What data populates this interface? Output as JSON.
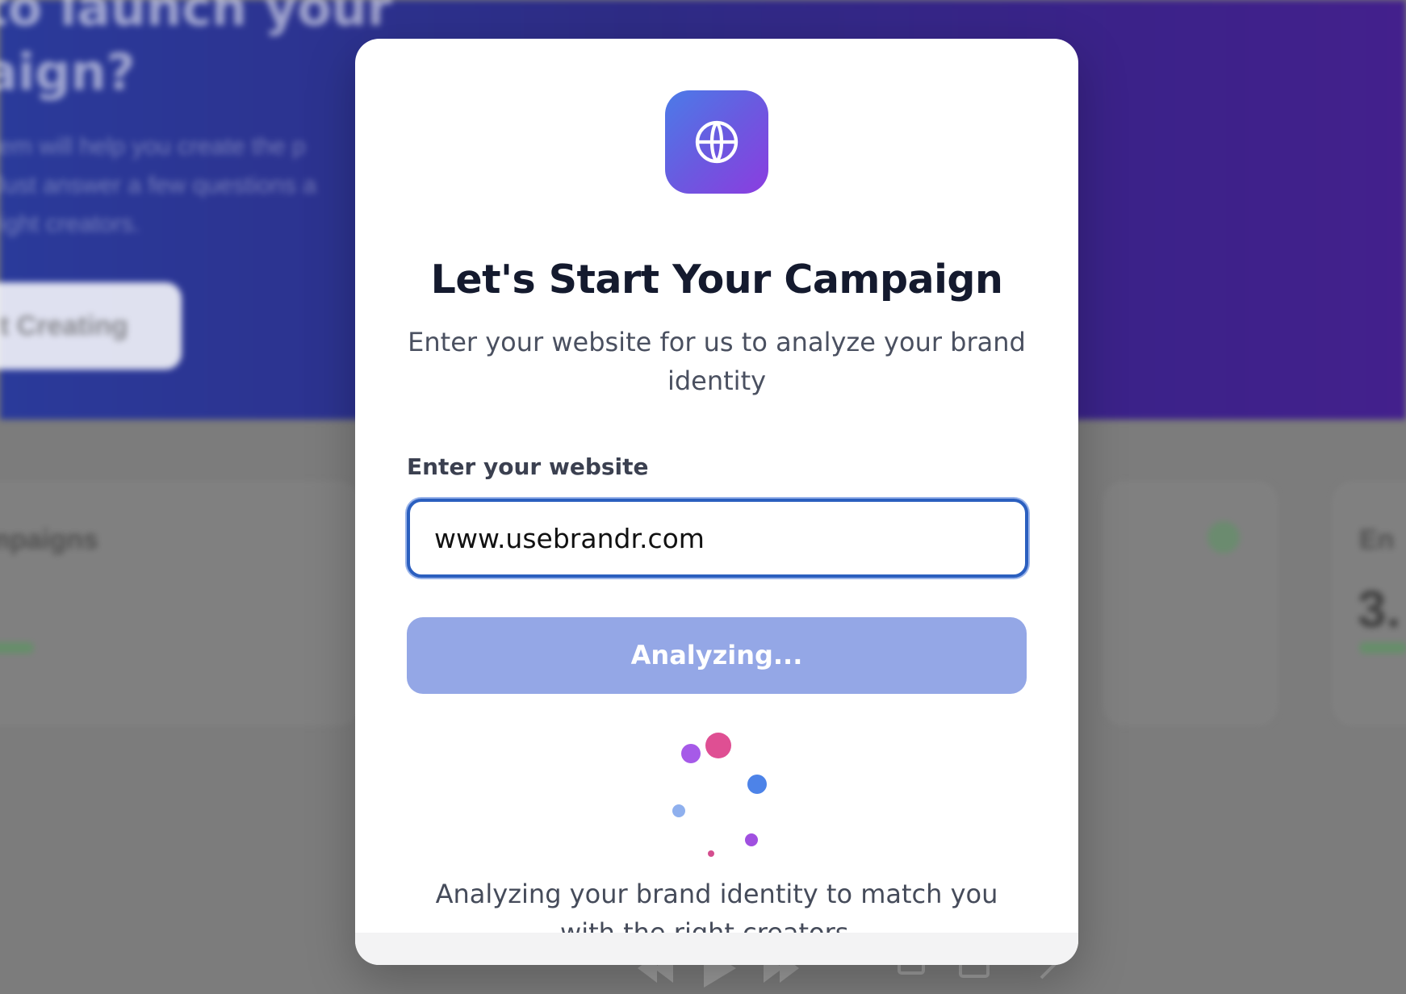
{
  "background": {
    "hero_heading": "to launch your\naign?",
    "hero_subtext": "tem will help you create the p\nJust answer a few questions a\nright creators.",
    "hero_button_label": "t Creating",
    "card_left_title": "mpaigns",
    "card_right_title": "En",
    "card_right_value": "3."
  },
  "modal": {
    "logo_icon": "globe-icon",
    "title": "Let's Start Your Campaign",
    "subtitle": "Enter your website for us to analyze your brand identity",
    "field_label": "Enter your website",
    "website_value": "www.usebrandr.com",
    "button_label": "Analyzing...",
    "status_text": "Analyzing your brand identity to match you with the right creators..."
  },
  "colors": {
    "accent": "#2b5fbf",
    "button_disabled": "#94a7e6",
    "title": "#141a2e",
    "logo_gradient_start": "#4b7be8",
    "logo_gradient_end": "#8b3de0"
  }
}
